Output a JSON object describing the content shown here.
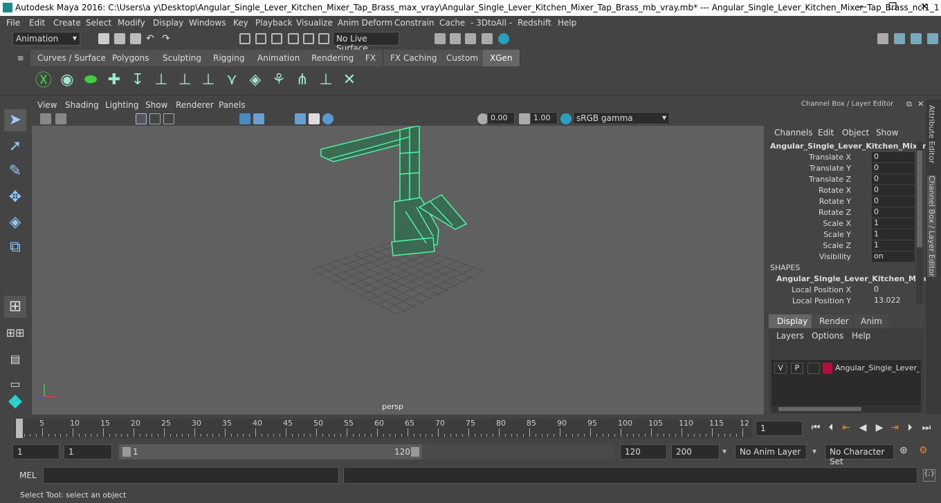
{
  "title_bar": {
    "text": "Autodesk Maya 2016: C:\\Users\\a y\\Desktop\\Angular_Single_Lever_Kitchen_Mixer_Tap_Brass_max_vray\\Angular_Single_Lever_Kitchen_Mixer_Tap_Brass_mb_vray.mb*   ---   Angular_Single_Lever_Kitchen_Mixer_Tap_Brass_ncl1_1",
    "minimize": "—",
    "maximize": "❐",
    "close": "✕"
  },
  "menubar": [
    "File",
    "Edit",
    "Create",
    "Select",
    "Modify",
    "Display",
    "Windows",
    "Key",
    "Playback",
    "Visualize",
    "Anim Deform",
    "Constrain",
    "Cache",
    "- 3DtoAll -",
    "Redshift",
    "Help"
  ],
  "status_line": {
    "menu_set": "Animation",
    "live_surface": "No Live Surface"
  },
  "shelf_tabs": [
    "Curves / Surfaces",
    "Polygons",
    "Sculpting",
    "Rigging",
    "Animation",
    "Rendering",
    "FX",
    "FX Caching",
    "Custom",
    "XGen"
  ],
  "active_shelf_tab": "XGen",
  "viewport_menu": [
    "View",
    "Shading",
    "Lighting",
    "Show",
    "Renderer",
    "Panels"
  ],
  "viewport_toolbar": {
    "exposure": "0.00",
    "gamma": "1.00",
    "color_space": "sRGB gamma"
  },
  "viewport": {
    "camera_label": "persp",
    "wire_color": "#4dffa6"
  },
  "channel_box": {
    "header": "Channel Box / Layer Editor",
    "menu": [
      "Channels",
      "Edit",
      "Object",
      "Show"
    ],
    "object_name": "Angular_Single_Lever_Kitchen_Mixer_...",
    "attributes": [
      {
        "name": "Translate X",
        "value": "0"
      },
      {
        "name": "Translate Y",
        "value": "0"
      },
      {
        "name": "Translate Z",
        "value": "0"
      },
      {
        "name": "Rotate X",
        "value": "0"
      },
      {
        "name": "Rotate Y",
        "value": "0"
      },
      {
        "name": "Rotate Z",
        "value": "0"
      },
      {
        "name": "Scale X",
        "value": "1"
      },
      {
        "name": "Scale Y",
        "value": "1"
      },
      {
        "name": "Scale Z",
        "value": "1"
      },
      {
        "name": "Visibility",
        "value": "on"
      }
    ],
    "shapes_header": "SHAPES",
    "shape_name": "Angular_Single_Lever_Kitchen_Mixe...",
    "shape_attributes": [
      {
        "name": "Local Position X",
        "value": "0"
      },
      {
        "name": "Local Position Y",
        "value": "13.022"
      }
    ]
  },
  "layer_editor": {
    "tabs": [
      "Display",
      "Render",
      "Anim"
    ],
    "active_tab": "Display",
    "menu": [
      "Layers",
      "Options",
      "Help"
    ],
    "layer": {
      "v": "V",
      "p": "P",
      "color": "#b0103a",
      "name": "Angular_Single_Lever_Kit"
    }
  },
  "side_tabs": [
    "Attribute Editor",
    "Channel Box / Layer Editor"
  ],
  "time_slider": {
    "ticks": [
      "5",
      "10",
      "15",
      "20",
      "25",
      "30",
      "35",
      "40",
      "45",
      "50",
      "55",
      "60",
      "65",
      "70",
      "75",
      "80",
      "85",
      "90",
      "95",
      "100",
      "105",
      "110",
      "115",
      "12"
    ],
    "start_label": "1",
    "current_frame": "1"
  },
  "range_slider": {
    "start_time": "1",
    "playback_start": "1",
    "range_start": "1",
    "range_end": "120",
    "playback_end": "120",
    "end_time": "200",
    "anim_layer": "No Anim Layer",
    "character_set": "No Character Set"
  },
  "command_line": {
    "label": "MEL"
  },
  "help_line": "Select Tool: select an object"
}
